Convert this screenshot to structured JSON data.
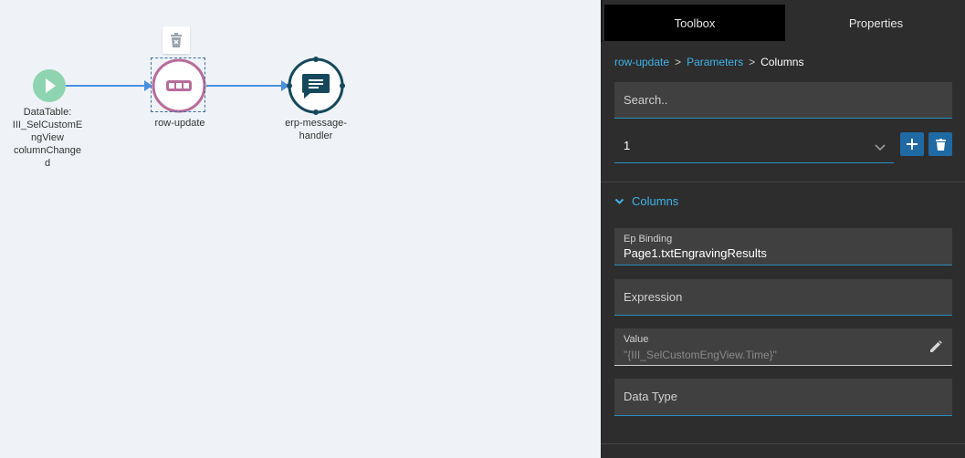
{
  "canvas": {
    "nodes": {
      "start": {
        "label": "DataTable: III_SelCustomEngView columnChanged",
        "label_lines": [
          "DataTable:",
          "III_SelCustomE",
          "ngView",
          "columnChange",
          "d"
        ],
        "icon": "play-icon",
        "color": "#8fd4b0"
      },
      "row_update": {
        "label": "row-update",
        "icon": "ellipsis-box-icon",
        "color": "#b76c9b"
      },
      "erp_handler": {
        "label_lines": [
          "erp-message-",
          "handler"
        ],
        "icon": "message-icon",
        "color": "#15485c"
      }
    },
    "connector_color": "#4a90e2",
    "delete_icon": "trash-icon"
  },
  "panel": {
    "tabs": [
      {
        "label": "Toolbox",
        "active": true
      },
      {
        "label": "Properties",
        "active": false
      }
    ],
    "breadcrumb": {
      "items": [
        "row-update",
        "Parameters"
      ],
      "current": "Columns",
      "separator": ">"
    },
    "search": {
      "placeholder": "Search..",
      "value": ""
    },
    "select": {
      "value": "1"
    },
    "buttons": {
      "add_icon": "plus-icon",
      "delete_icon": "trash-icon"
    },
    "section": {
      "title": "Columns",
      "expanded": true
    },
    "fields": {
      "ep_binding": {
        "label": "Ep Binding",
        "value": "Page1.txtEngravingResults"
      },
      "expression": {
        "label": "Expression",
        "value": ""
      },
      "value": {
        "label": "Value",
        "value": "\"{III_SelCustomEngView.Time}\""
      },
      "data_type": {
        "label": "Data Type",
        "value": ""
      }
    },
    "colors": {
      "accent": "#3eb3e8",
      "button": "#1f6aa3",
      "panel_bg": "#2d2d2d",
      "field_bg": "#404040"
    }
  }
}
